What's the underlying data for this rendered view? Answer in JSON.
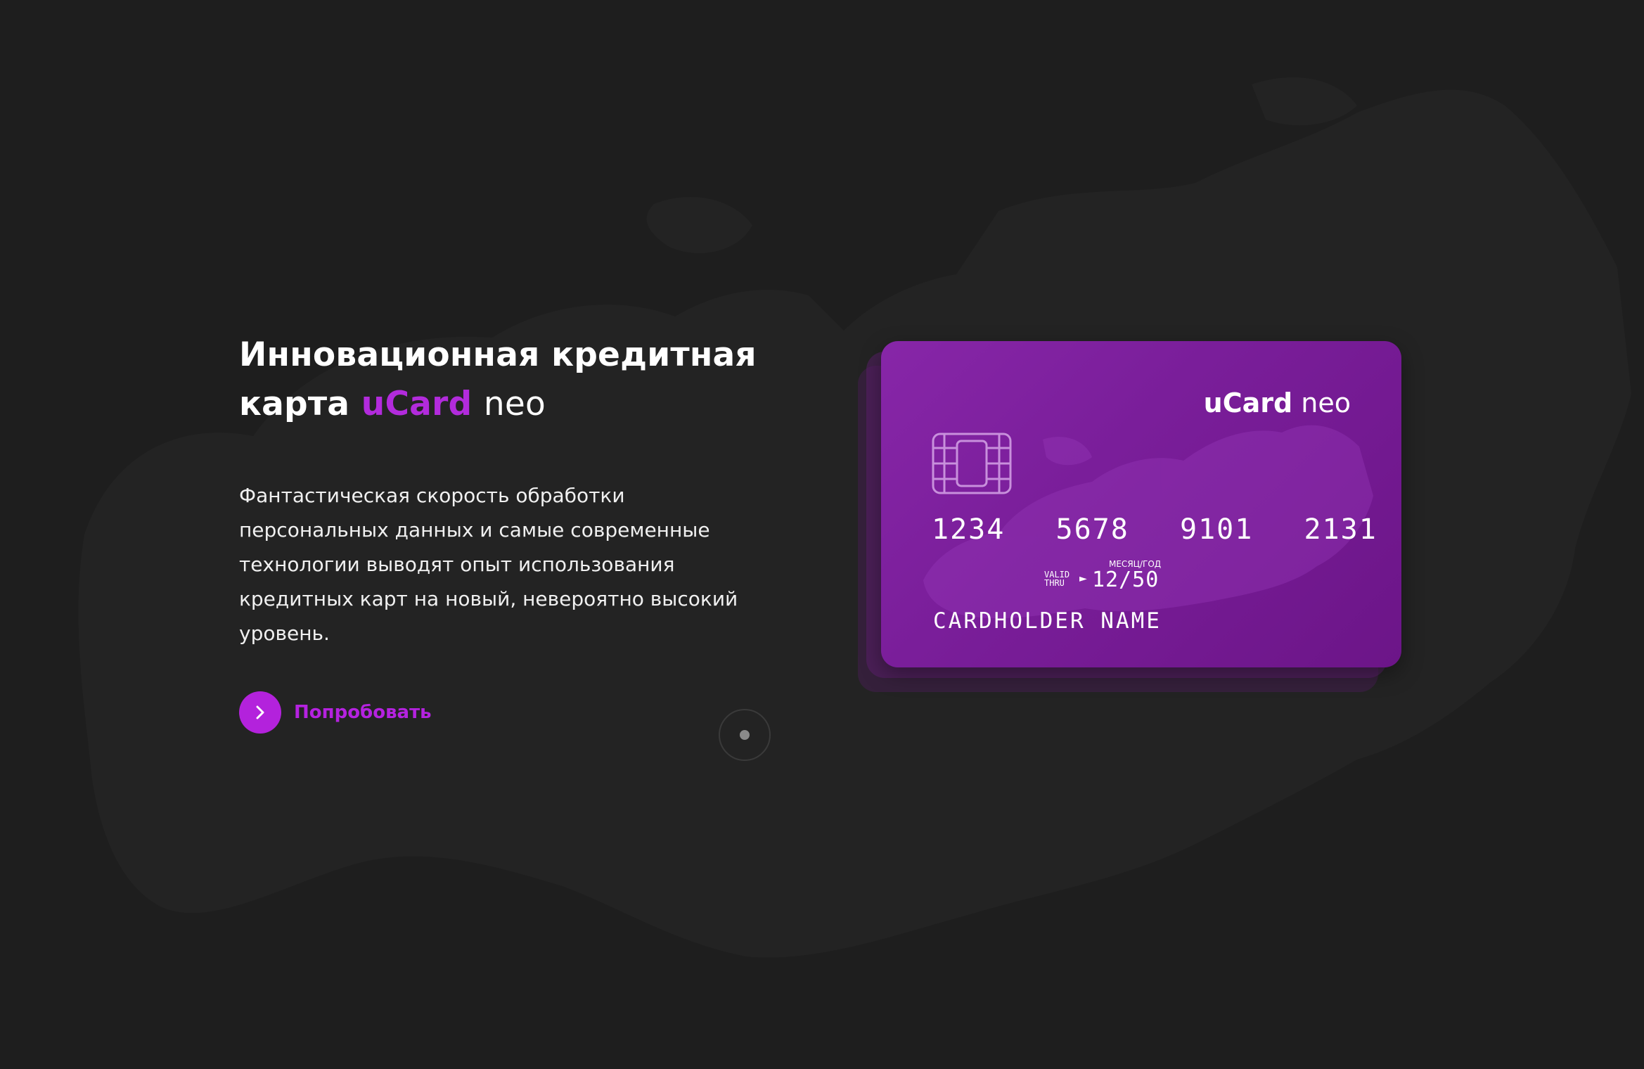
{
  "hero": {
    "title_line1": "Инновационная кредитная",
    "title_line2_prefix": "карта",
    "title_brand": "uCard",
    "title_suffix": "neo",
    "description": "Фантастическая скорость обработки персональных данных и самые современные технологии выводят опыт использования кредитных карт на новый, невероятно высокий уровень.",
    "cta_label": "Попробовать",
    "cta_icon": "chevron-right-icon"
  },
  "card": {
    "brand": "uCard",
    "brand_suffix": "neo",
    "number": "1234  5678  9101  2131",
    "valid_label_line1": "VALID",
    "valid_label_line2": "THRU",
    "valid_caption": "МЕСЯЦ/ГОД",
    "valid_date": "12/50",
    "holder": "CARDHOLDER NAME",
    "chip_icon": "chip-icon"
  },
  "slider": {
    "active_index": 0
  },
  "colors": {
    "background": "#1e1e1e",
    "accent": "#b322dc",
    "card_start": "#8726a8",
    "card_end": "#6c1588"
  }
}
